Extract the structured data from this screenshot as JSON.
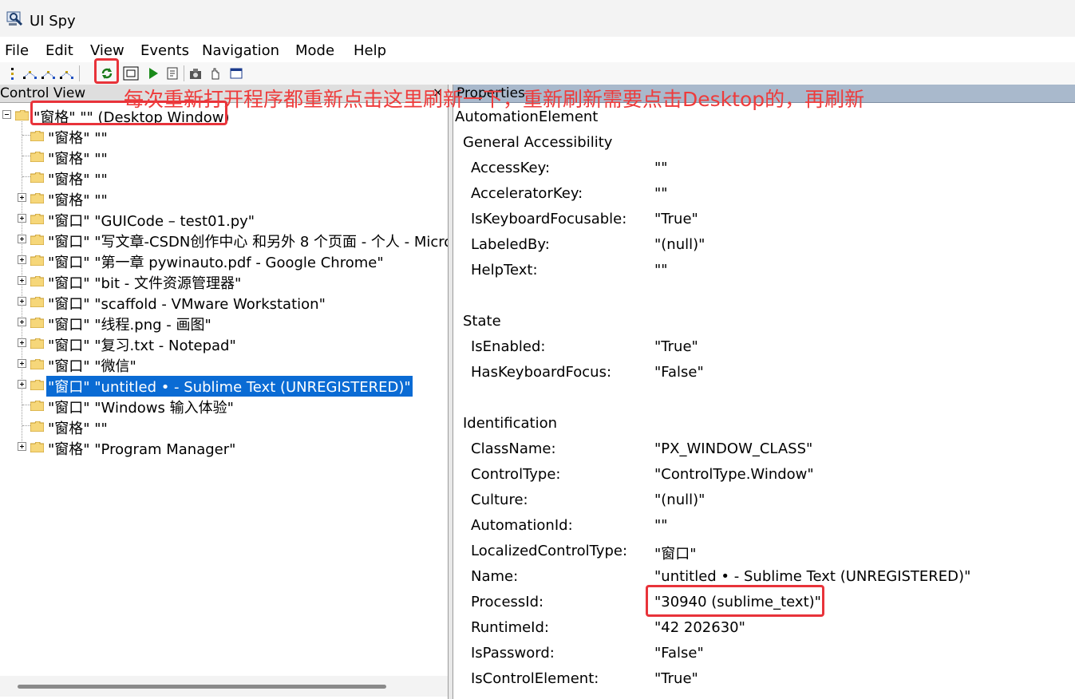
{
  "window": {
    "title": "UI Spy"
  },
  "menu": [
    "File",
    "Edit",
    "View",
    "Events",
    "Navigation",
    "Mode",
    "Help"
  ],
  "toolbar": {
    "buttons": [
      "nav-parent-icon",
      "nav-first-child-icon",
      "nav-next-sibling-icon",
      "nav-prev-sibling-icon",
      "refresh-icon",
      "highlight-icon",
      "play-icon",
      "properties-icon",
      "snapshot-icon",
      "hand-icon",
      "window-icon"
    ]
  },
  "control_view": {
    "title": "Control View",
    "close": "×",
    "tree": [
      {
        "label": "\"窗格\" \"\" (Desktop Window)"
      },
      {
        "label": "\"窗格\" \"\""
      },
      {
        "label": "\"窗格\" \"\""
      },
      {
        "label": "\"窗格\" \"\""
      },
      {
        "label": "\"窗格\" \"\""
      },
      {
        "label": "\"窗口\" \"GUICode – test01.py\""
      },
      {
        "label": "\"窗口\" \"写文章-CSDN创作中心 和另外 8 个页面 - 个人 - Micro"
      },
      {
        "label": "\"窗口\" \"第一章 pywinauto.pdf - Google Chrome\""
      },
      {
        "label": "\"窗口\" \"bit - 文件资源管理器\""
      },
      {
        "label": "\"窗口\" \"scaffold - VMware Workstation\""
      },
      {
        "label": "\"窗口\" \"线程.png - 画图\""
      },
      {
        "label": "\"窗口\" \"复习.txt - Notepad\""
      },
      {
        "label": "\"窗口\" \"微信\""
      },
      {
        "label": "\"窗口\" \"untitled • - Sublime Text (UNREGISTERED)\""
      },
      {
        "label": "\"窗口\" \"Windows 输入体验\""
      },
      {
        "label": "\"窗格\" \"\""
      },
      {
        "label": "\"窗格\" \"Program Manager\""
      }
    ]
  },
  "properties": {
    "title": "Properties",
    "root": "AutomationElement",
    "general": {
      "title": "General Accessibility",
      "rows": [
        {
          "key": "AccessKey:",
          "value": "\"\""
        },
        {
          "key": "AcceleratorKey:",
          "value": "\"\""
        },
        {
          "key": "IsKeyboardFocusable:",
          "value": "\"True\""
        },
        {
          "key": "LabeledBy:",
          "value": "\"(null)\""
        },
        {
          "key": "HelpText:",
          "value": "\"\""
        }
      ]
    },
    "state": {
      "title": "State",
      "rows": [
        {
          "key": "IsEnabled:",
          "value": "\"True\""
        },
        {
          "key": "HasKeyboardFocus:",
          "value": "\"False\""
        }
      ]
    },
    "identification": {
      "title": "Identification",
      "rows": [
        {
          "key": "ClassName:",
          "value": "\"PX_WINDOW_CLASS\""
        },
        {
          "key": "ControlType:",
          "value": "\"ControlType.Window\""
        },
        {
          "key": "Culture:",
          "value": "\"(null)\""
        },
        {
          "key": "AutomationId:",
          "value": "\"\""
        },
        {
          "key": "LocalizedControlType:",
          "value": "\"窗口\""
        },
        {
          "key": "Name:",
          "value": "\"untitled • - Sublime Text (UNREGISTERED)\""
        },
        {
          "key": "ProcessId:",
          "value": "\"30940 (sublime_text)\""
        },
        {
          "key": "RuntimeId:",
          "value": "\"42 202630\""
        },
        {
          "key": "IsPassword:",
          "value": "\"False\""
        },
        {
          "key": "IsControlElement:",
          "value": "\"True\""
        }
      ]
    }
  },
  "annotation": {
    "text": "每次重新打开程序都重新点击这里刷新一下，重新刷新需要点击Desktop的，再刷新",
    "color": "#ee3b3b"
  },
  "colors": {
    "selection": "#0a6bd4",
    "annotation": "#e8333a",
    "pane_header": "#a9b9cc"
  }
}
